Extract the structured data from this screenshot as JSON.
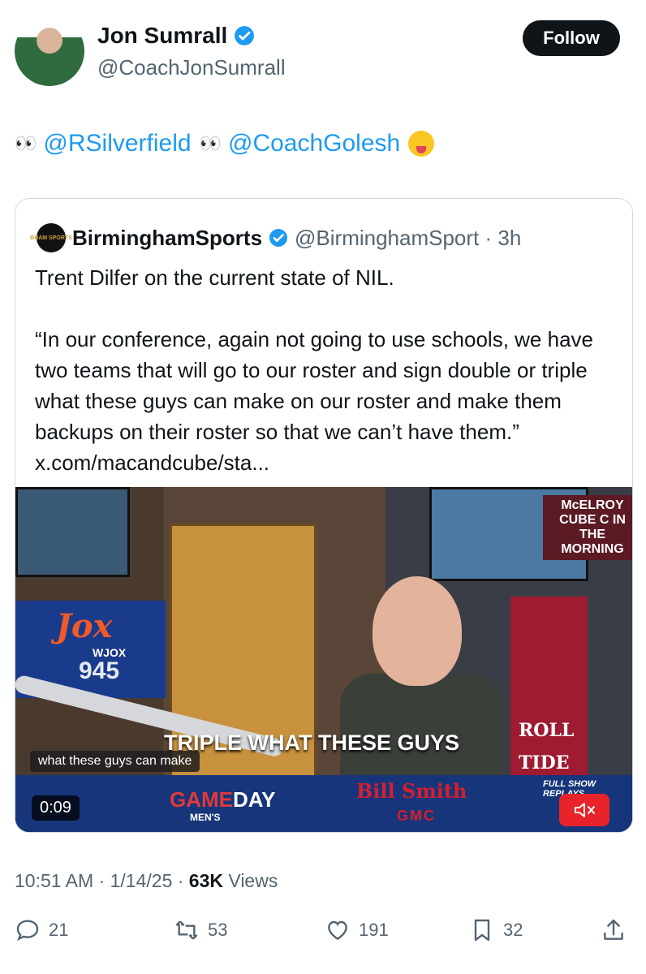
{
  "author": {
    "name": "Jon Sumrall",
    "handle": "@CoachJonSumrall",
    "verified": true,
    "follow_label": "Follow"
  },
  "tweet": {
    "mention1": "@RSilverfield",
    "mention2": "@CoachGolesh"
  },
  "quote": {
    "logo_text": "BHAM SPORTS",
    "name": "BirminghamSports",
    "handle_time": "@BirminghamSport · 3h",
    "line1": "Trent Dilfer on the current state of NIL.",
    "line2": "“In our conference, again not going to use schools, we have two teams that will go to our roster and sign double or triple what these guys can make on our roster and make them backups on their roster so that we can’t have them.” x.com/macandcube/sta..."
  },
  "video": {
    "station_logo": "Jox",
    "station_call": "WJOX",
    "station_freq": "945",
    "show_name": "McELROY CUBE C IN THE MORNING",
    "banner_text": "ROLL TIDE",
    "caption": "TRIPLE WHAT THESE GUYS",
    "auto_caption": "what these guys can make",
    "gameday_a": "GAME",
    "gameday_b": "DAY",
    "mens": "MEN'S",
    "sponsor": "Bill Smith",
    "sponsor_brand": "GMC",
    "replays": "FULL SHOW REPLAYS",
    "timer": "0:09"
  },
  "meta": {
    "time": "10:51 AM · 1/14/25 · ",
    "views_count": "63K",
    "views_label": " Views"
  },
  "actions": {
    "replies": "21",
    "reposts": "53",
    "likes": "191",
    "bookmarks": "32"
  },
  "colors": {
    "link": "#1d9bf0",
    "muted": "#536471",
    "verified": "#1d9bf0"
  }
}
